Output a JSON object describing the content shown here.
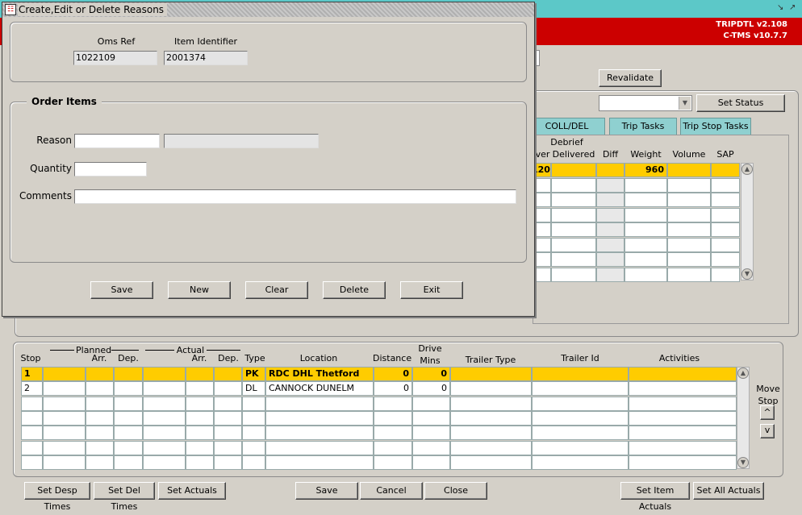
{
  "main": {
    "version_line1": "TRIPDTL v2.108",
    "version_line2": "C-TMS v10.7.7",
    "revalidate_label": "Revalidate",
    "set_status_label": "Set Status",
    "tabs": [
      "COLL/DEL Debrief",
      "Trip Tasks",
      "Trip Stop Tasks"
    ],
    "items_headers": [
      "iver",
      "Delivered",
      "Diff",
      "Weight",
      "Volume",
      "SAP"
    ],
    "items_first_row": {
      "driver": "120",
      "weight": "960"
    },
    "stops": {
      "headers": {
        "stop": "Stop",
        "planned": "Planned",
        "actual": "Actual",
        "arr": "Arr.",
        "dep": "Dep.",
        "type": "Type",
        "location": "Location",
        "distance": "Distance",
        "drive": "Drive",
        "mins": "Mins",
        "trailer_type": "Trailer Type",
        "trailer_id": "Trailer Id",
        "activities": "Activities"
      },
      "rows": [
        {
          "stop": "1",
          "type": "PK",
          "location": "RDC DHL Thetford",
          "distance": "0",
          "mins": "0"
        },
        {
          "stop": "2",
          "type": "DL",
          "location": "CANNOCK DUNELM",
          "distance": "0",
          "mins": "0"
        }
      ],
      "move_stop_line1": "Move",
      "move_stop_line2": "Stop",
      "up_label": "^",
      "down_label": "v"
    },
    "bottom_buttons": {
      "set_desp_times": "Set Desp Times",
      "set_del_times": "Set Del Times",
      "set_actuals": "Set Actuals",
      "save": "Save",
      "cancel": "Cancel",
      "close": "Close",
      "set_item_actuals": "Set Item Actuals",
      "set_all_actuals": "Set All Actuals"
    }
  },
  "dialog": {
    "title": "Create,Edit or Delete Reasons",
    "oms_ref_label": "Oms Ref",
    "oms_ref_value": "1022109",
    "item_identifier_label": "Item Identifier",
    "item_identifier_value": "2001374",
    "order_items_label": "Order Items",
    "reason_label": "Reason",
    "quantity_label": "Quantity",
    "comments_label": "Comments",
    "buttons": {
      "save": "Save",
      "new": "New",
      "clear": "Clear",
      "delete": "Delete",
      "exit": "Exit"
    }
  },
  "colors": {
    "title_bar": "#5cc8c8",
    "version_bar": "#cc0000",
    "highlight_row": "#ffcc00",
    "tab": "#8fd0d0"
  }
}
